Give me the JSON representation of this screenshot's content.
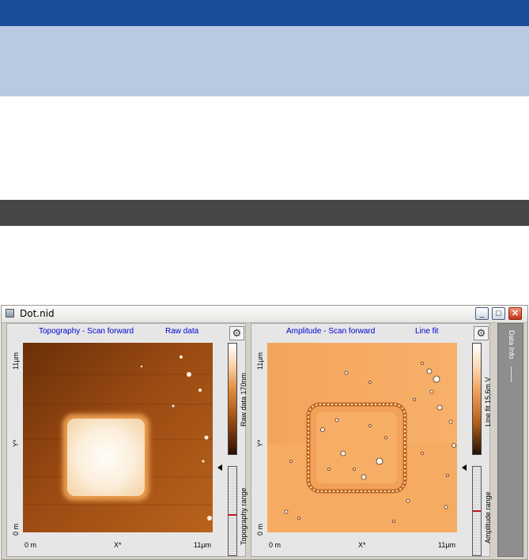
{
  "window": {
    "title": "Dot.nid",
    "min_glyph": "_",
    "max_glyph": "□",
    "close_glyph": "✕"
  },
  "topography": {
    "channel": "Topography - Scan forward",
    "mode": "Raw data",
    "y_max": "11µm",
    "y_axis": "Y*",
    "y_min": "0 m",
    "x_min": "0 m",
    "x_axis": "X*",
    "x_max": "11µm",
    "colorbar_label": "Raw data 170nm",
    "range_label": "Topography range",
    "gear_icon": "gear-icon"
  },
  "amplitude": {
    "channel": "Amplitude - Scan forward",
    "mode": "Line fit",
    "y_max": "11µm",
    "y_axis": "Y*",
    "y_min": "0 m",
    "x_min": "0 m",
    "x_axis": "X*",
    "x_max": "11µm",
    "colorbar_label": "Line fit 15,6m V",
    "range_label": "Amplitude range",
    "gear_icon": "gear-icon"
  },
  "side_tab": {
    "label": "Data Info"
  },
  "colors": {
    "header_blue": "#1b4c9a",
    "header_light": "#b8c9e1",
    "band_dark": "#474747",
    "title_link": "#0000d0"
  }
}
